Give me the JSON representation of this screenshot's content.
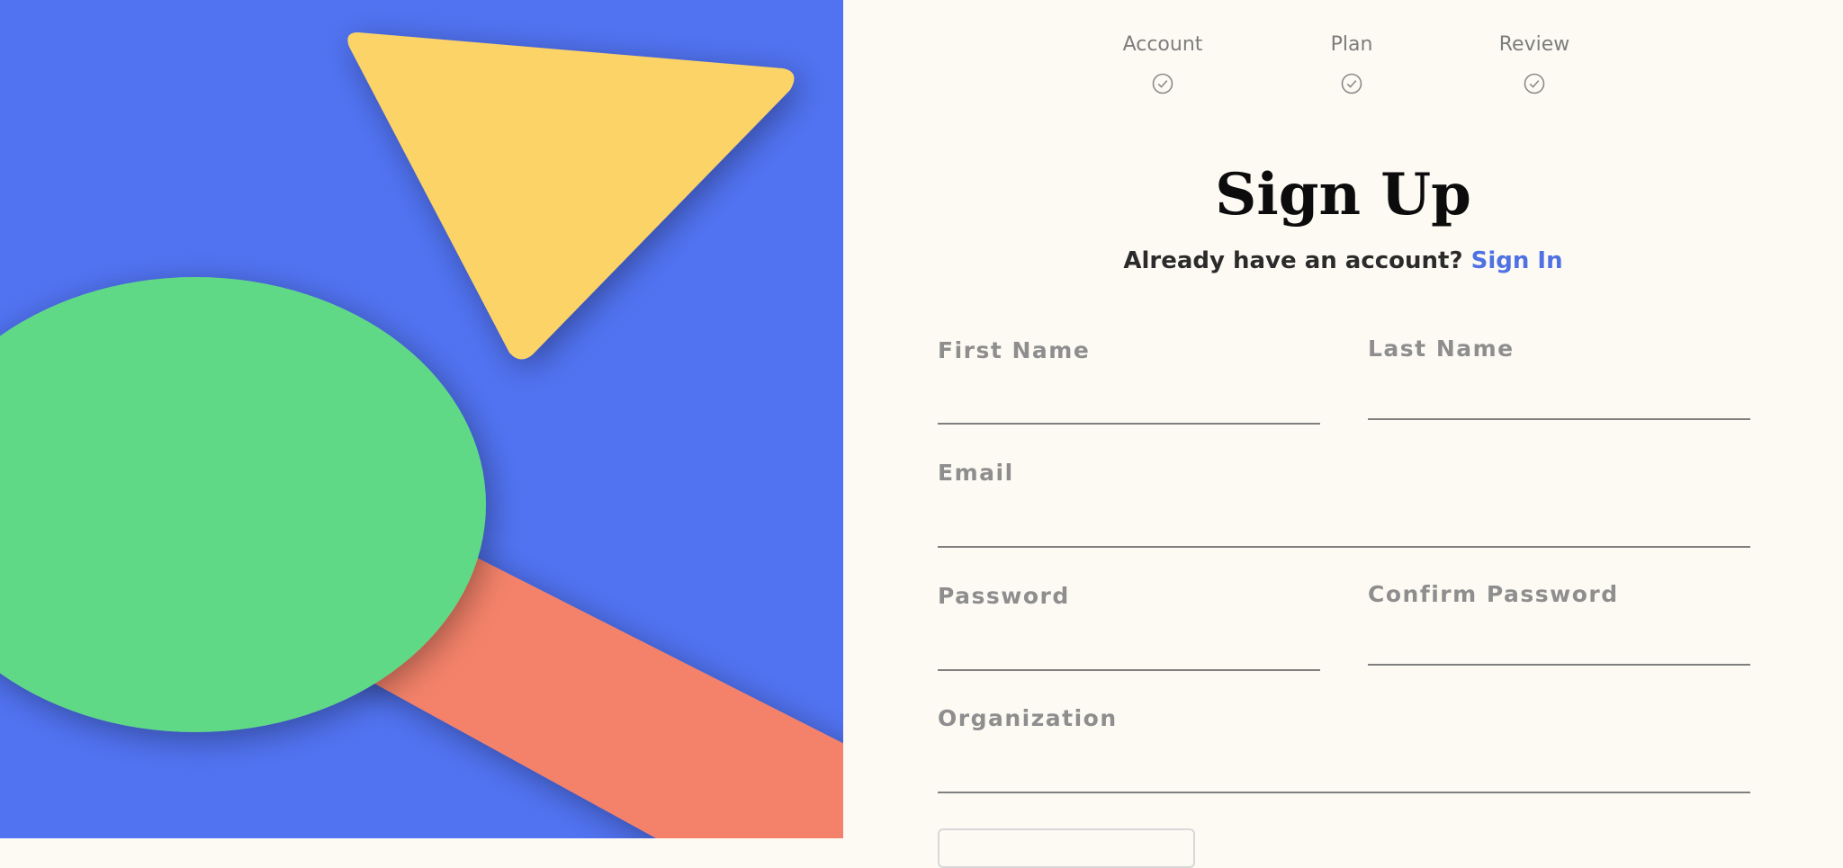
{
  "stepper": {
    "steps": [
      {
        "label": "Account",
        "icon": "check-circle-icon"
      },
      {
        "label": "Plan",
        "icon": "check-circle-icon"
      },
      {
        "label": "Review",
        "icon": "check-circle-icon"
      }
    ]
  },
  "form": {
    "title": "Sign Up",
    "subtitle_prefix": "Already have an account?",
    "signin_link": "Sign In",
    "fields": {
      "first_name": {
        "label": "First Name",
        "value": ""
      },
      "last_name": {
        "label": "Last Name",
        "value": ""
      },
      "email": {
        "label": "Email",
        "value": ""
      },
      "password": {
        "label": "Password",
        "value": ""
      },
      "confirm_password": {
        "label": "Confirm Password",
        "value": ""
      },
      "organization": {
        "label": "Organization",
        "value": ""
      }
    }
  },
  "colors": {
    "art_background": "#5173f2",
    "triangle": "#fcd366",
    "circle": "#61d987",
    "band": "#f4826b",
    "accent_link": "#4f72e3",
    "page_background": "#fdfaf4"
  }
}
